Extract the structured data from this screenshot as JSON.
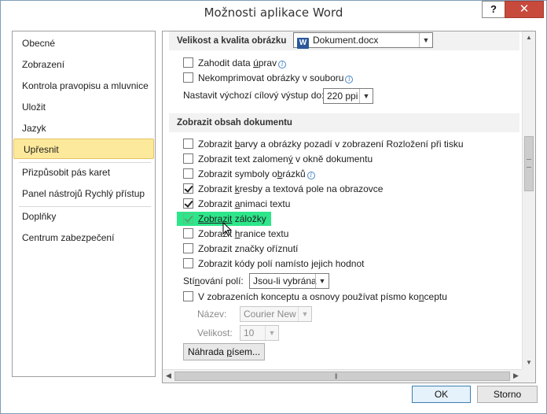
{
  "window": {
    "title": "Možnosti aplikace Word",
    "help_label": "?",
    "close_label": "✕"
  },
  "nav": {
    "items": [
      {
        "label": "Obecné"
      },
      {
        "label": "Zobrazení"
      },
      {
        "label": "Kontrola pravopisu a mluvnice"
      },
      {
        "label": "Uložit"
      },
      {
        "label": "Jazyk"
      },
      {
        "label": "Upřesnit",
        "selected": true
      },
      {
        "label": "Přizpůsobit pás karet"
      },
      {
        "label": "Panel nástrojů Rychlý přístup"
      },
      {
        "label": "Doplňky"
      },
      {
        "label": "Centrum zabezpečení"
      }
    ]
  },
  "image_section": {
    "header": "Velikost a kvalita obrázku",
    "document_select": "Dokument.docx",
    "discard_edit_data": {
      "pre": "Zahodit data ",
      "u": "ú",
      "post": "prav",
      "checked": false
    },
    "no_compress": {
      "label": "Nekomprimovat obrázky v souboru",
      "checked": false
    },
    "default_output_label": "Nastavit výchozí cílový výstup do:",
    "default_output_value": "220 ppi"
  },
  "content_section": {
    "header": "Zobrazit obsah dokumentu",
    "options": [
      {
        "pre": "Zobrazit ",
        "u": "b",
        "post": "arvy a obrázky pozadí v zobrazení Rozložení při tisku",
        "checked": false
      },
      {
        "pre": "Zobrazit text zalomen",
        "u": "ý",
        "post": " v okně dokumentu",
        "checked": false
      },
      {
        "pre": "Zobrazit symboly o",
        "u": "b",
        "post": "rázků",
        "checked": false,
        "info": true
      },
      {
        "pre": "Zobrazit ",
        "u": "k",
        "post": "resby a textová pole na obrazovce",
        "checked": true
      },
      {
        "pre": "Zobrazit ",
        "u": "a",
        "post": "nimaci textu",
        "checked": true
      },
      {
        "pre": "",
        "u": "Zobrazit",
        "post": " záložky",
        "checked": true,
        "highlight": true
      },
      {
        "pre": "Zobrazit ",
        "u": "h",
        "post": "ranice textu",
        "checked": false
      },
      {
        "pre": "Zobrazit značky oříznutí",
        "u": "",
        "post": "",
        "checked": false
      },
      {
        "pre": "Zobrazit kódy polí namísto jejich hodnot",
        "u": "",
        "post": "",
        "checked": false
      }
    ],
    "shading_label_pre": "Stí",
    "shading_label_u": "n",
    "shading_label_post": "ování polí:",
    "shading_value": "Jsou-li vybrána",
    "draft_font": {
      "pre": "V zobrazeních konceptu a osnovy používat písmo ko",
      "u": "n",
      "post": "ceptu",
      "checked": false
    },
    "name_label": "Název:",
    "name_value": "Courier New",
    "size_label": "Velikost:",
    "size_value": "10",
    "font_sub_button_pre": "Náhrada ",
    "font_sub_button_u": "p",
    "font_sub_button_post": "ísem..."
  },
  "buttons": {
    "ok": "OK",
    "cancel": "Storno"
  },
  "icons": {
    "info": "i",
    "dropdown": "▼",
    "scroll_up": "▲",
    "scroll_down": "▼",
    "scroll_left": "◀",
    "scroll_right": "▶",
    "word_doc": "W",
    "grip": "|||"
  }
}
